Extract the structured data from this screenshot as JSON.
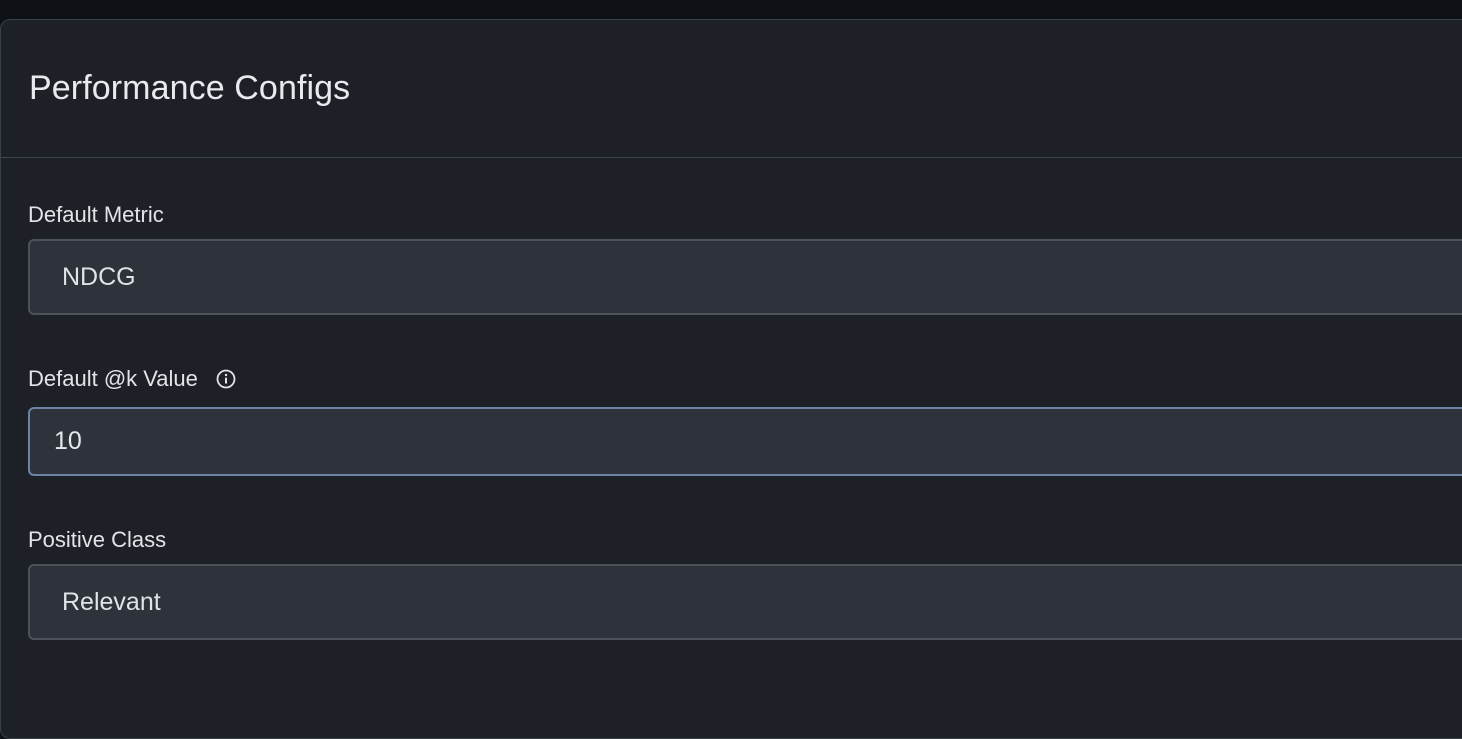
{
  "panel": {
    "title": "Performance Configs"
  },
  "fields": {
    "default_metric": {
      "label": "Default Metric",
      "value": "NDCG"
    },
    "default_k": {
      "label": "Default @k Value",
      "value": "10",
      "icon": "info-icon"
    },
    "positive_class": {
      "label": "Positive Class",
      "value": "Relevant"
    }
  },
  "colors": {
    "background": "#1e2028",
    "field_background": "#2e333b",
    "field_border": "#4c515a",
    "focused_border": "#6b84a3",
    "text": "#e2e4e8"
  }
}
